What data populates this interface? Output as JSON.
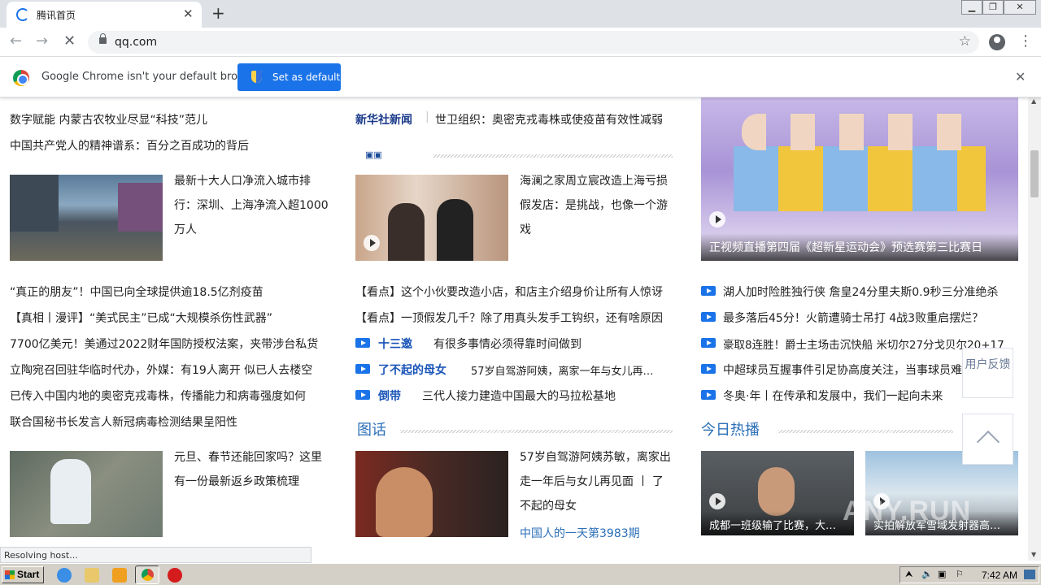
{
  "browser": {
    "tab_title": "腾讯首页",
    "url": "qq.com",
    "infobar_text": "Google Chrome isn't your default browser",
    "set_default_label": "Set as default",
    "status_text": "Resolving host..."
  },
  "col1": {
    "lines_top": [
      "数字赋能 内蒙古农牧业尽显“科技”范儿",
      "中国共产党人的精神谱系：百分之百成功的背后"
    ],
    "feature1_text": "最新十大人口净流入城市排行：深圳、上海净流入超1000万人",
    "lines_mid": [
      "“真正的朋友”！中国已向全球提供逾18.5亿剂疫苗",
      "【真相丨漫评】“美式民主”已成“大规模杀伤性武器”",
      "7700亿美元！美通过2022财年国防授权法案，夹带涉台私货",
      "立陶宛召回驻华临时代办，外媒：有19人离开 似已人去楼空",
      "已传入中国内地的奥密克戎毒株，传播能力和病毒强度如何",
      "联合国秘书长发言人新冠病毒检测结果呈阳性"
    ],
    "feature2_text": "元旦、春节还能回家吗？这里有一份最新返乡政策梳理"
  },
  "col2": {
    "xinhua_tag": "新华社新闻",
    "xinhua_text": "世卫组织：奥密克戎毒株或使疫苗有效性减弱",
    "feature_text": "海澜之家周立宸改造上海亏损假发店：是挑战，也像一个游戏",
    "kandian": [
      "【看点】这个小伙要改造小店，和店主介绍身价让所有人惊讶",
      "【看点】一顶假发几千？除了用真头发手工钩织，还有啥原因"
    ],
    "video_items": [
      {
        "tag": "十三邀",
        "text": "有很多事情必须得靠时间做到"
      },
      {
        "tag": "了不起的母女",
        "text": "57岁自驾游阿姨，离家一年与女儿再…"
      },
      {
        "tag": "倒带",
        "text": "三代人接力建造中国最大的马拉松基地"
      }
    ],
    "section_title": "图话",
    "photo_text": "57岁自驾游阿姨苏敏，离家出走一年后与女儿再见面 丨 了不起的母女",
    "photo_sub": "中国人的一天第3983期"
  },
  "col3": {
    "promo_caption": "正视频直播第四届《超新星运动会》预选赛第三比赛日",
    "video_items": [
      "湖人加时险胜独行侠 詹皇24分里夫斯0.9秒三分准绝杀",
      "最多落后45分！火箭遭骑士吊打 4战3败重启摆烂？",
      "豪取8连胜！爵士主场击沉快船 米切尔27分戈贝尔20+17",
      "中超球员互握事件引足协高度关注，当事球员难",
      "冬奥·年丨在传承和发展中，我们一起向未来"
    ],
    "section_title": "今日热播",
    "hot_captions": [
      "成都一班级输了比赛，大…",
      "实拍解放军雪域发射器高…"
    ]
  },
  "sidebar": {
    "feedback_label": "用户反馈"
  },
  "taskbar": {
    "start_label": "Start",
    "clock": "7:42 AM"
  }
}
